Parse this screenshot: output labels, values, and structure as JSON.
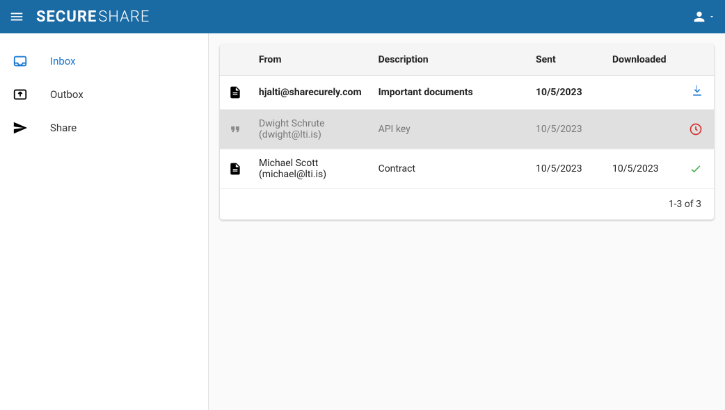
{
  "brand": {
    "bold": "SECURE",
    "light": "SHARE"
  },
  "sidebar": {
    "items": [
      {
        "label": "Inbox"
      },
      {
        "label": "Outbox"
      },
      {
        "label": "Share"
      }
    ]
  },
  "table": {
    "headers": {
      "from": "From",
      "description": "Description",
      "sent": "Sent",
      "downloaded": "Downloaded"
    },
    "rows": [
      {
        "from": "hjalti@sharecurely.com",
        "description": "Important documents",
        "sent": "10/5/2023",
        "downloaded": ""
      },
      {
        "from": "Dwight Schrute (dwight@lti.is)",
        "description": "API key",
        "sent": "10/5/2023",
        "downloaded": ""
      },
      {
        "from": "Michael Scott (michael@lti.is)",
        "description": "Contract",
        "sent": "10/5/2023",
        "downloaded": "10/5/2023"
      }
    ],
    "pager": "1-3 of 3"
  }
}
